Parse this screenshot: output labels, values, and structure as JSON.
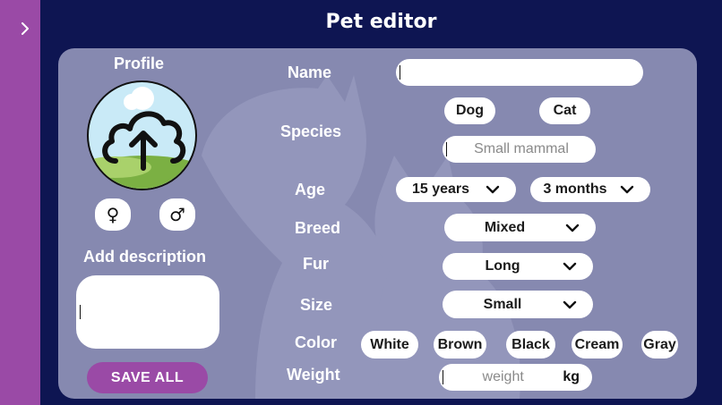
{
  "app": {
    "title": "Pet editor"
  },
  "sidebar": {
    "toggle_icon": "chevron-right-icon"
  },
  "profile": {
    "label": "Profile",
    "avatar_icon": "cloud-upload-icon",
    "female_symbol": "♀",
    "male_symbol": "♂",
    "description_label": "Add description",
    "description_value": ""
  },
  "form": {
    "name": {
      "label": "Name",
      "value": ""
    },
    "species": {
      "label": "Species",
      "options": [
        "Dog",
        "Cat"
      ],
      "other_placeholder": "Small mammal"
    },
    "age": {
      "label": "Age",
      "years": "15 years",
      "months": "3 months"
    },
    "breed": {
      "label": "Breed",
      "value": "Mixed"
    },
    "fur": {
      "label": "Fur",
      "value": "Long"
    },
    "size": {
      "label": "Size",
      "value": "Small"
    },
    "color": {
      "label": "Color",
      "options": [
        "White",
        "Brown",
        "Black",
        "Cream",
        "Gray"
      ]
    },
    "weight": {
      "label": "Weight",
      "placeholder": "weight",
      "unit": "kg"
    }
  },
  "actions": {
    "save_label": "SAVE ALL"
  },
  "colors": {
    "sidebar": "#9a4aa6",
    "background": "#0e1552",
    "card": "#8689b0",
    "button": "#9a4aa6"
  }
}
